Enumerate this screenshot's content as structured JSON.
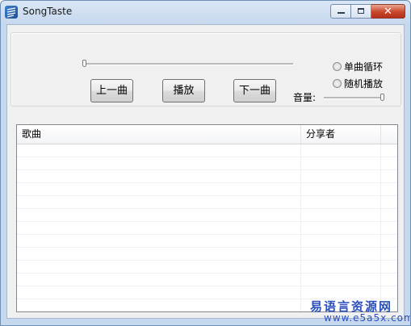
{
  "window": {
    "title": "SongTaste"
  },
  "player": {
    "progress": 0.0,
    "prev_label": "上一曲",
    "play_label": "播放",
    "next_label": "下一曲",
    "mode_single_label": "单曲循环",
    "mode_random_label": "随机播放",
    "volume_label": "音量:",
    "volume": 1.0
  },
  "playlist": {
    "columns": [
      "歌曲",
      "分享者"
    ],
    "rows": []
  },
  "watermark": {
    "text": "易语言资源网",
    "url": "www.e5a5x.com"
  },
  "colors": {
    "title_bar": "#c6d8ee",
    "close_button": "#c9462a",
    "watermark": "#2a4fbf"
  }
}
